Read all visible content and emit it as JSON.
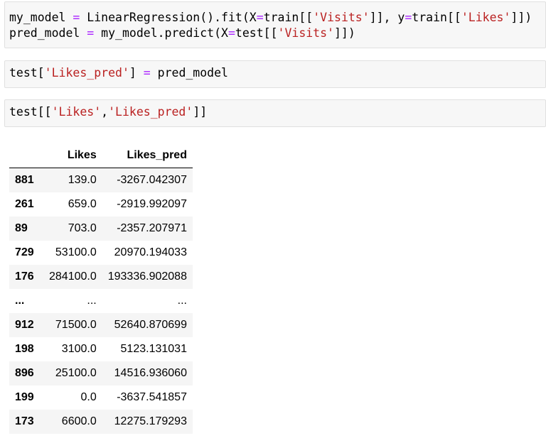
{
  "cells": [
    {
      "lines": [
        [
          {
            "t": "my_model",
            "k": "var"
          },
          {
            "t": " ",
            "k": "var"
          },
          {
            "t": "=",
            "k": "op"
          },
          {
            "t": " LinearRegression().fit(X",
            "k": "var"
          },
          {
            "t": "=",
            "k": "op"
          },
          {
            "t": "train[[",
            "k": "var"
          },
          {
            "t": "'Visits'",
            "k": "str"
          },
          {
            "t": "]], y",
            "k": "var"
          },
          {
            "t": "=",
            "k": "op"
          },
          {
            "t": "train[[",
            "k": "var"
          },
          {
            "t": "'Likes'",
            "k": "str"
          },
          {
            "t": "]])",
            "k": "var"
          }
        ],
        [
          {
            "t": "pred_model",
            "k": "var"
          },
          {
            "t": " ",
            "k": "var"
          },
          {
            "t": "=",
            "k": "op"
          },
          {
            "t": " my_model.predict(X",
            "k": "var"
          },
          {
            "t": "=",
            "k": "op"
          },
          {
            "t": "test[[",
            "k": "var"
          },
          {
            "t": "'Visits'",
            "k": "str"
          },
          {
            "t": "]])",
            "k": "var"
          }
        ]
      ]
    },
    {
      "lines": [
        [
          {
            "t": "test[",
            "k": "var"
          },
          {
            "t": "'Likes_pred'",
            "k": "str"
          },
          {
            "t": "] ",
            "k": "var"
          },
          {
            "t": "=",
            "k": "op"
          },
          {
            "t": " pred_model",
            "k": "var"
          }
        ]
      ]
    },
    {
      "lines": [
        [
          {
            "t": "test[[",
            "k": "var"
          },
          {
            "t": "'Likes'",
            "k": "str"
          },
          {
            "t": ",",
            "k": "var"
          },
          {
            "t": "'Likes_pred'",
            "k": "str"
          },
          {
            "t": "]]",
            "k": "var"
          }
        ]
      ]
    }
  ],
  "dataframe": {
    "columns": [
      "",
      "Likes",
      "Likes_pred"
    ],
    "rows": [
      [
        "881",
        "139.0",
        "-3267.042307"
      ],
      [
        "261",
        "659.0",
        "-2919.992097"
      ],
      [
        "89",
        "703.0",
        "-2357.207971"
      ],
      [
        "729",
        "53100.0",
        "20970.194033"
      ],
      [
        "176",
        "284100.0",
        "193336.902088"
      ],
      [
        "...",
        "...",
        "..."
      ],
      [
        "912",
        "71500.0",
        "52640.870699"
      ],
      [
        "198",
        "3100.0",
        "5123.131031"
      ],
      [
        "896",
        "25100.0",
        "14516.936060"
      ],
      [
        "199",
        "0.0",
        "-3637.541857"
      ],
      [
        "173",
        "6600.0",
        "12275.179293"
      ]
    ]
  },
  "colors": {
    "string": "#ba2121",
    "operator": "#aa22ff",
    "cell_background": "#f7f7f7",
    "row_stripe": "#f5f5f5"
  }
}
